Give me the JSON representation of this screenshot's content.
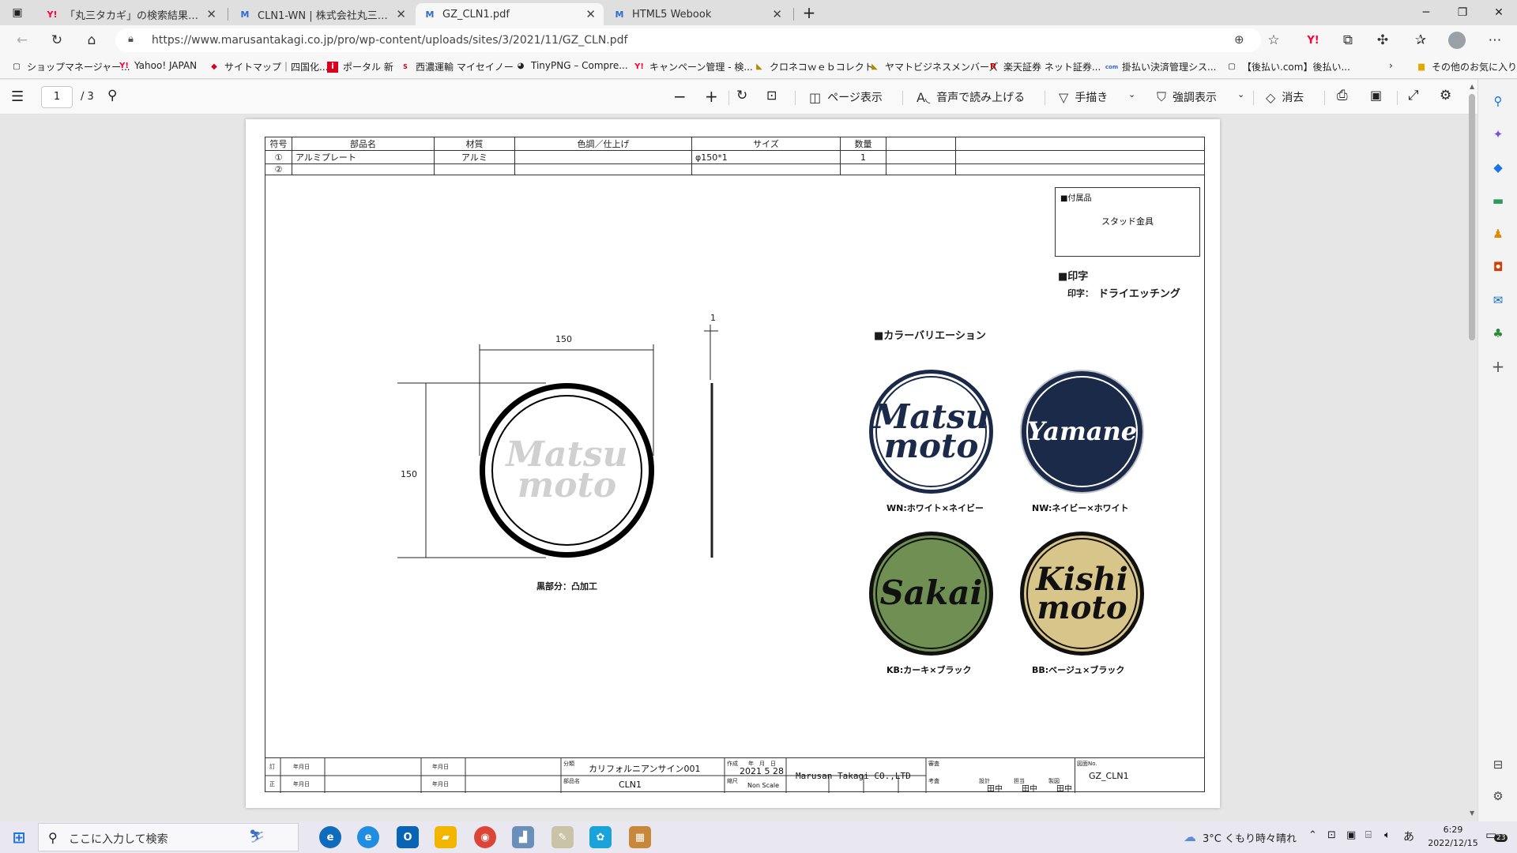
{
  "browser": {
    "tabs": [
      {
        "title": "「丸三タカギ」の検索結果 - Yahoo!検索",
        "fav": "Y!",
        "fav_color": "#ff0033"
      },
      {
        "title": "CLN1-WN | 株式会社丸三タカギ",
        "fav": "M",
        "fav_color": "#2d6bd4"
      },
      {
        "title": "GZ_CLN1.pdf",
        "fav": "M",
        "fav_color": "#2d6bd4",
        "active": true
      },
      {
        "title": "HTML5 Webook",
        "fav": "M",
        "fav_color": "#2d6bd4"
      }
    ],
    "new_tab": "+",
    "url": "https://www.marusantakagi.co.jp/pro/wp-content/uploads/sites/3/2021/11/GZ_CLN.pdf",
    "bookmarks": [
      {
        "label": "ショップマネージャー...",
        "icon": "doc-icon"
      },
      {
        "label": "Yahoo! JAPAN",
        "icon": "yahoo-icon"
      },
      {
        "label": "サイトマップ｜四国化...",
        "icon": "shikoku-icon"
      },
      {
        "label": "ポータル 新",
        "icon": "portal-icon"
      },
      {
        "label": "西濃運輸 マイセイノー",
        "icon": "seino-icon"
      },
      {
        "label": "TinyPNG – Compre...",
        "icon": "panda-icon"
      },
      {
        "label": "キャンペーン管理 - 検...",
        "icon": "yahoo-icon"
      },
      {
        "label": "クロネコｗｅｂコレクト",
        "icon": "cat-icon"
      },
      {
        "label": "ヤマトビジネスメンバーズ",
        "icon": "cat-icon"
      },
      {
        "label": "楽天証券 ネット証券...",
        "icon": "rakuten-icon"
      },
      {
        "label": "掛払い決済管理シス...",
        "icon": "com-icon"
      },
      {
        "label": "【後払い.com】後払い...",
        "icon": "doc-icon"
      }
    ],
    "bookmarks_other": "その他のお気に入り"
  },
  "pdf_toolbar": {
    "page": "1",
    "page_total": "/ 3",
    "page_view": "ページ表示",
    "read_aloud": "音声で読み上げる",
    "draw": "手描き",
    "highlight": "強調表示",
    "erase": "消去"
  },
  "drawing": {
    "parts_table": {
      "headers": [
        "符号",
        "部品名",
        "材質",
        "色調／仕上げ",
        "サイズ",
        "数量",
        "",
        ""
      ],
      "rows": [
        [
          "①",
          "アルミプレート",
          "アルミ",
          "",
          "φ150*1",
          "1",
          "",
          ""
        ],
        [
          "②",
          "",
          "",
          "",
          "",
          "",
          "",
          ""
        ]
      ]
    },
    "accessory_title": "■付属品",
    "accessory_value": "スタッド金具",
    "printing_title": "■印字",
    "printing_label": "印字：",
    "printing_value": "ドライエッチング",
    "variation_title": "■カラーバリエーション",
    "dim_width": "150",
    "dim_height": "150",
    "dim_thickness": "1",
    "plate_sample": [
      "Matsu",
      "moto"
    ],
    "black_note": "黒部分：凸加工",
    "variations": [
      {
        "lines": [
          "Matsu",
          "moto"
        ],
        "label": "WN:ホワイト×ネイビー",
        "bg": "#ffffff",
        "fg": "#1c2a4a",
        "ring": "#1c2a4a"
      },
      {
        "lines": [
          "Yamane"
        ],
        "label": "NW:ネイビー×ホワイト",
        "bg": "#1c2a4a",
        "fg": "#ffffff",
        "ring": "#ffffff"
      },
      {
        "lines": [
          "Sakai"
        ],
        "label": "KB:カーキ×ブラック",
        "bg": "#6f8f53",
        "fg": "#111111",
        "ring": "#111111"
      },
      {
        "lines": [
          "Kishi",
          "moto"
        ],
        "label": "BB:ベージュ×ブラック",
        "bg": "#d8c58a",
        "fg": "#111111",
        "ring": "#111111"
      }
    ],
    "title_block": {
      "category_label": "分類",
      "category": "カリフォルニアンサイン001",
      "part_label": "部品名",
      "part": "CLN1",
      "date_label": "作成",
      "date_heads": "年　月　日",
      "date": "2021 5 28",
      "scale_label": "縮尺",
      "scale": "Non Scale",
      "company": "Marusan Takagi CO.,LTD",
      "approve_label": "審査",
      "check_label": "考査",
      "design_label": "設計",
      "draft_label": "担当",
      "trace_label": "製図",
      "names": [
        "田中",
        "田中",
        "田中"
      ],
      "drawing_no_label": "図面No.",
      "drawing_no": "GZ_CLN1",
      "rev_labels": [
        "訂",
        "正"
      ],
      "date_mark": "年月日"
    }
  },
  "taskbar": {
    "search_placeholder": "ここに入力して検索",
    "weather": "3°C くもり時々晴れ",
    "time": "6:29",
    "date": "2022/12/15",
    "ime": "あ",
    "notifications": "23"
  }
}
